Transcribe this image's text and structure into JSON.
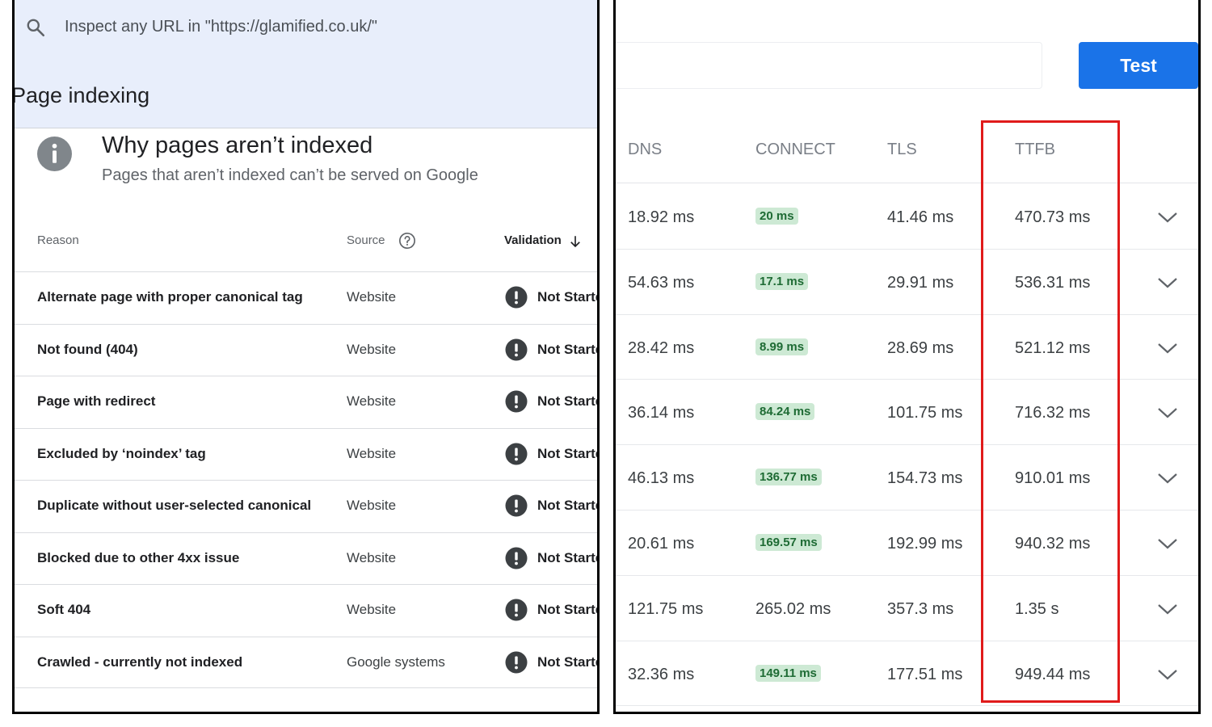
{
  "left_panel": {
    "search": {
      "placeholder": "Inspect any URL in \"https://glamified.co.uk/\""
    },
    "page_heading": "Page indexing",
    "section": {
      "title": "Why pages aren’t indexed",
      "subtitle": "Pages that aren’t indexed can’t be served on Google"
    },
    "columns": {
      "reason": "Reason",
      "source": "Source",
      "validation": "Validation"
    },
    "rows": [
      {
        "reason": "Alternate page with proper canonical tag",
        "source": "Website",
        "validation": "Not Starte"
      },
      {
        "reason": "Not found (404)",
        "source": "Website",
        "validation": "Not Starte"
      },
      {
        "reason": "Page with redirect",
        "source": "Website",
        "validation": "Not Starte"
      },
      {
        "reason": "Excluded by ‘noindex’ tag",
        "source": "Website",
        "validation": "Not Starte"
      },
      {
        "reason": "Duplicate without user-selected canonical",
        "source": "Website",
        "validation": "Not Starte"
      },
      {
        "reason": "Blocked due to other 4xx issue",
        "source": "Website",
        "validation": "Not Starte"
      },
      {
        "reason": "Soft 404",
        "source": "Website",
        "validation": "Not Starte"
      },
      {
        "reason": "Crawled - currently not indexed",
        "source": "Google systems",
        "validation": "Not Starte"
      }
    ],
    "colors": {
      "header_bg": "#e8eefb",
      "warn_icon": "#3c4043"
    }
  },
  "right_panel": {
    "test_button": "Test",
    "columns": {
      "dns": "DNS",
      "connect": "CONNECT",
      "tls": "TLS",
      "ttfb": "TTFB"
    },
    "rows": [
      {
        "dns": "18.92 ms",
        "connect": "20 ms",
        "connect_highlight": true,
        "tls": "41.46 ms",
        "ttfb": "470.73 ms"
      },
      {
        "dns": "54.63 ms",
        "connect": "17.1 ms",
        "connect_highlight": true,
        "tls": "29.91 ms",
        "ttfb": "536.31 ms"
      },
      {
        "dns": "28.42 ms",
        "connect": "8.99 ms",
        "connect_highlight": true,
        "tls": "28.69 ms",
        "ttfb": "521.12 ms"
      },
      {
        "dns": "36.14 ms",
        "connect": "84.24 ms",
        "connect_highlight": true,
        "tls": "101.75 ms",
        "ttfb": "716.32 ms"
      },
      {
        "dns": "46.13 ms",
        "connect": "136.77 ms",
        "connect_highlight": true,
        "tls": "154.73 ms",
        "ttfb": "910.01 ms"
      },
      {
        "dns": "20.61 ms",
        "connect": "169.57 ms",
        "connect_highlight": true,
        "tls": "192.99 ms",
        "ttfb": "940.32 ms"
      },
      {
        "dns": "121.75 ms",
        "connect": "265.02 ms",
        "connect_highlight": false,
        "tls": "357.3 ms",
        "ttfb": "1.35 s"
      },
      {
        "dns": "32.36 ms",
        "connect": "149.11 ms",
        "connect_highlight": true,
        "tls": "177.51 ms",
        "ttfb": "949.44 ms"
      }
    ],
    "colors": {
      "button": "#1a73e8",
      "pill_bg": "#cde9d4",
      "pill_text": "#1e6b34",
      "highlight_box": "#e01b1b"
    }
  }
}
